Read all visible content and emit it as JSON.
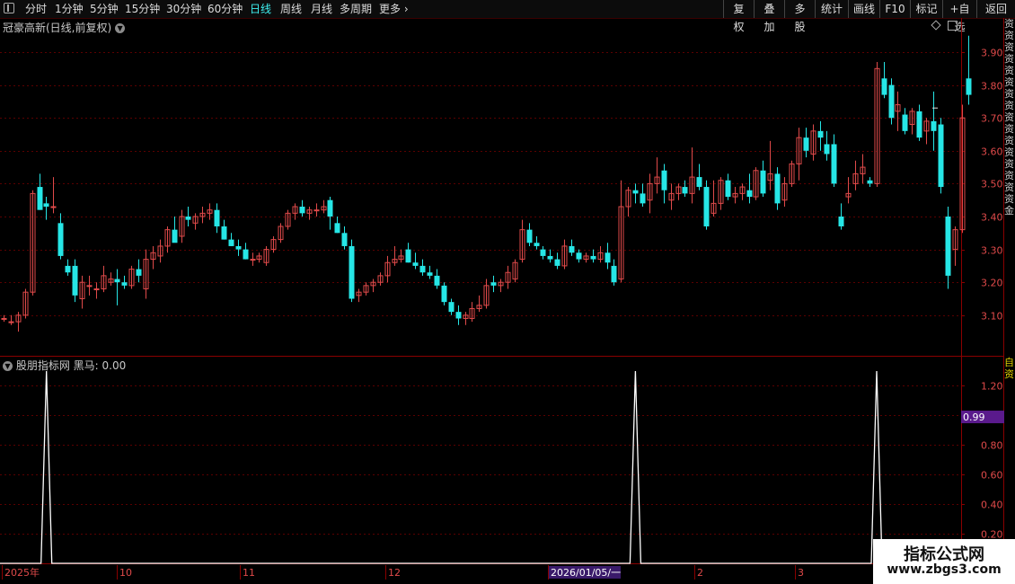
{
  "toolbar": {
    "periods": [
      {
        "label": "分时",
        "active": false
      },
      {
        "label": "1分钟",
        "active": false
      },
      {
        "label": "5分钟",
        "active": false
      },
      {
        "label": "15分钟",
        "active": false
      },
      {
        "label": "30分钟",
        "active": false
      },
      {
        "label": "60分钟",
        "active": false
      },
      {
        "label": "日线",
        "active": true
      },
      {
        "label": "周线",
        "active": false
      },
      {
        "label": "月线",
        "active": false
      },
      {
        "label": "多周期",
        "active": false
      },
      {
        "label": "更多",
        "active": false
      }
    ],
    "right_buttons": [
      "复权",
      "叠加",
      "多股",
      "统计",
      "画线",
      "F10",
      "标记",
      "+自选",
      "返回"
    ]
  },
  "main_title": "冠豪高新(日线,前复权)",
  "indicator_title": "股朋指标网",
  "indicator_value_text": "黑马: 0.00",
  "indicator_current_tag": "0.99",
  "right_strip_text": "资资资资资资资资资资资资资资资资金",
  "right_strip_text_lower": "自资",
  "watermark": {
    "title": "指标公式网",
    "url": "www.zbgs3.com"
  },
  "colors": {
    "up": "#e04a4a",
    "down": "#26e6e6",
    "grid": "#5a0000",
    "text": "#c8c8c8",
    "active": "#3ef0f0",
    "tag": "#5a1a8c"
  },
  "chart_data": [
    {
      "type": "candlestick",
      "title": "冠豪高新(日线,前复权)",
      "ylim": [
        3.0,
        3.98
      ],
      "yticks": [
        "3.90",
        "3.80",
        "3.70",
        "3.60",
        "3.50",
        "3.40",
        "3.30",
        "3.20",
        "3.10"
      ],
      "xticks": [
        "2025年",
        "10",
        "11",
        "12",
        "2026/01/05/一",
        "2",
        "3"
      ],
      "ohlc": [
        [
          3.09,
          3.1,
          3.08,
          3.09
        ],
        [
          3.08,
          3.1,
          3.07,
          3.08
        ],
        [
          3.08,
          3.11,
          3.05,
          3.1
        ],
        [
          3.1,
          3.18,
          3.09,
          3.17
        ],
        [
          3.17,
          3.48,
          3.16,
          3.47
        ],
        [
          3.49,
          3.53,
          3.42,
          3.42
        ],
        [
          3.44,
          3.46,
          3.39,
          3.43
        ],
        [
          3.43,
          3.52,
          3.41,
          3.43
        ],
        [
          3.38,
          3.41,
          3.27,
          3.28
        ],
        [
          3.25,
          3.27,
          3.22,
          3.23
        ],
        [
          3.25,
          3.27,
          3.14,
          3.16
        ],
        [
          3.15,
          3.22,
          3.12,
          3.2
        ],
        [
          3.19,
          3.22,
          3.16,
          3.19
        ],
        [
          3.18,
          3.2,
          3.15,
          3.18
        ],
        [
          3.18,
          3.25,
          3.17,
          3.22
        ],
        [
          3.2,
          3.23,
          3.19,
          3.21
        ],
        [
          3.21,
          3.24,
          3.13,
          3.2
        ],
        [
          3.2,
          3.22,
          3.18,
          3.19
        ],
        [
          3.19,
          3.25,
          3.18,
          3.24
        ],
        [
          3.24,
          3.27,
          3.2,
          3.22
        ],
        [
          3.18,
          3.3,
          3.15,
          3.27
        ],
        [
          3.27,
          3.31,
          3.24,
          3.29
        ],
        [
          3.28,
          3.33,
          3.26,
          3.31
        ],
        [
          3.31,
          3.37,
          3.29,
          3.36
        ],
        [
          3.36,
          3.4,
          3.33,
          3.32
        ],
        [
          3.34,
          3.42,
          3.32,
          3.4
        ],
        [
          3.4,
          3.43,
          3.37,
          3.39
        ],
        [
          3.38,
          3.41,
          3.36,
          3.4
        ],
        [
          3.4,
          3.43,
          3.38,
          3.41
        ],
        [
          3.41,
          3.44,
          3.39,
          3.42
        ],
        [
          3.42,
          3.44,
          3.35,
          3.37
        ],
        [
          3.37,
          3.39,
          3.33,
          3.33
        ],
        [
          3.33,
          3.35,
          3.31,
          3.31
        ],
        [
          3.31,
          3.33,
          3.28,
          3.3
        ],
        [
          3.3,
          3.32,
          3.27,
          3.27
        ],
        [
          3.27,
          3.29,
          3.25,
          3.27
        ],
        [
          3.27,
          3.29,
          3.26,
          3.28
        ],
        [
          3.26,
          3.31,
          3.25,
          3.3
        ],
        [
          3.3,
          3.34,
          3.29,
          3.33
        ],
        [
          3.33,
          3.38,
          3.32,
          3.37
        ],
        [
          3.37,
          3.42,
          3.36,
          3.41
        ],
        [
          3.41,
          3.44,
          3.39,
          3.43
        ],
        [
          3.43,
          3.45,
          3.4,
          3.41
        ],
        [
          3.41,
          3.43,
          3.39,
          3.42
        ],
        [
          3.42,
          3.44,
          3.4,
          3.42
        ],
        [
          3.42,
          3.45,
          3.41,
          3.43
        ],
        [
          3.45,
          3.46,
          3.36,
          3.4
        ],
        [
          3.38,
          3.4,
          3.35,
          3.35
        ],
        [
          3.35,
          3.37,
          3.3,
          3.31
        ],
        [
          3.31,
          3.33,
          3.14,
          3.15
        ],
        [
          3.16,
          3.18,
          3.14,
          3.17
        ],
        [
          3.17,
          3.2,
          3.16,
          3.19
        ],
        [
          3.19,
          3.21,
          3.17,
          3.2
        ],
        [
          3.2,
          3.23,
          3.19,
          3.22
        ],
        [
          3.22,
          3.28,
          3.2,
          3.26
        ],
        [
          3.26,
          3.31,
          3.25,
          3.27
        ],
        [
          3.27,
          3.3,
          3.26,
          3.28
        ],
        [
          3.3,
          3.32,
          3.26,
          3.26
        ],
        [
          3.26,
          3.29,
          3.24,
          3.25
        ],
        [
          3.25,
          3.27,
          3.22,
          3.23
        ],
        [
          3.23,
          3.25,
          3.21,
          3.22
        ],
        [
          3.22,
          3.24,
          3.18,
          3.19
        ],
        [
          3.19,
          3.2,
          3.13,
          3.14
        ],
        [
          3.14,
          3.15,
          3.1,
          3.11
        ],
        [
          3.11,
          3.13,
          3.07,
          3.09
        ],
        [
          3.09,
          3.11,
          3.07,
          3.1
        ],
        [
          3.09,
          3.14,
          3.08,
          3.12
        ],
        [
          3.12,
          3.16,
          3.11,
          3.13
        ],
        [
          3.13,
          3.21,
          3.12,
          3.19
        ],
        [
          3.2,
          3.22,
          3.17,
          3.19
        ],
        [
          3.19,
          3.21,
          3.17,
          3.2
        ],
        [
          3.2,
          3.25,
          3.18,
          3.23
        ],
        [
          3.21,
          3.27,
          3.2,
          3.26
        ],
        [
          3.27,
          3.39,
          3.26,
          3.36
        ],
        [
          3.36,
          3.38,
          3.31,
          3.32
        ],
        [
          3.32,
          3.34,
          3.3,
          3.31
        ],
        [
          3.3,
          3.31,
          3.27,
          3.28
        ],
        [
          3.28,
          3.3,
          3.26,
          3.27
        ],
        [
          3.27,
          3.29,
          3.24,
          3.25
        ],
        [
          3.25,
          3.33,
          3.24,
          3.31
        ],
        [
          3.31,
          3.33,
          3.28,
          3.29
        ],
        [
          3.29,
          3.3,
          3.26,
          3.27
        ],
        [
          3.27,
          3.29,
          3.26,
          3.28
        ],
        [
          3.28,
          3.3,
          3.26,
          3.27
        ],
        [
          3.27,
          3.31,
          3.26,
          3.29
        ],
        [
          3.29,
          3.32,
          3.24,
          3.26
        ],
        [
          3.25,
          3.27,
          3.19,
          3.2
        ],
        [
          3.21,
          3.51,
          3.2,
          3.43
        ],
        [
          3.43,
          3.49,
          3.4,
          3.48
        ],
        [
          3.48,
          3.5,
          3.44,
          3.47
        ],
        [
          3.47,
          3.5,
          3.43,
          3.44
        ],
        [
          3.45,
          3.53,
          3.41,
          3.5
        ],
        [
          3.5,
          3.58,
          3.47,
          3.52
        ],
        [
          3.54,
          3.56,
          3.44,
          3.48
        ],
        [
          3.45,
          3.5,
          3.42,
          3.47
        ],
        [
          3.47,
          3.5,
          3.45,
          3.49
        ],
        [
          3.49,
          3.51,
          3.46,
          3.47
        ],
        [
          3.47,
          3.61,
          3.44,
          3.52
        ],
        [
          3.52,
          3.56,
          3.48,
          3.49
        ],
        [
          3.49,
          3.51,
          3.36,
          3.37
        ],
        [
          3.41,
          3.51,
          3.4,
          3.44
        ],
        [
          3.44,
          3.52,
          3.42,
          3.51
        ],
        [
          3.51,
          3.53,
          3.45,
          3.46
        ],
        [
          3.46,
          3.49,
          3.44,
          3.47
        ],
        [
          3.47,
          3.5,
          3.45,
          3.49
        ],
        [
          3.48,
          3.53,
          3.44,
          3.46
        ],
        [
          3.46,
          3.55,
          3.45,
          3.54
        ],
        [
          3.54,
          3.57,
          3.46,
          3.47
        ],
        [
          3.51,
          3.63,
          3.48,
          3.53
        ],
        [
          3.53,
          3.55,
          3.42,
          3.44
        ],
        [
          3.45,
          3.52,
          3.43,
          3.5
        ],
        [
          3.5,
          3.57,
          3.49,
          3.56
        ],
        [
          3.56,
          3.67,
          3.51,
          3.64
        ],
        [
          3.64,
          3.67,
          3.58,
          3.6
        ],
        [
          3.59,
          3.68,
          3.57,
          3.66
        ],
        [
          3.66,
          3.69,
          3.6,
          3.64
        ],
        [
          3.62,
          3.66,
          3.57,
          3.59
        ],
        [
          3.62,
          3.65,
          3.49,
          3.5
        ],
        [
          3.4,
          3.44,
          3.36,
          3.37
        ],
        [
          3.46,
          3.52,
          3.44,
          3.47
        ],
        [
          3.5,
          3.57,
          3.48,
          3.53
        ],
        [
          3.53,
          3.59,
          3.5,
          3.55
        ],
        [
          3.51,
          3.52,
          3.49,
          3.5
        ],
        [
          3.5,
          3.87,
          3.49,
          3.85
        ],
        [
          3.82,
          3.87,
          3.76,
          3.77
        ],
        [
          3.8,
          3.82,
          3.68,
          3.7
        ],
        [
          3.72,
          3.78,
          3.66,
          3.74
        ],
        [
          3.71,
          3.73,
          3.65,
          3.66
        ],
        [
          3.68,
          3.73,
          3.65,
          3.72
        ],
        [
          3.72,
          3.74,
          3.63,
          3.64
        ],
        [
          3.66,
          3.7,
          3.62,
          3.69
        ],
        [
          3.69,
          3.78,
          3.6,
          3.66
        ],
        [
          3.68,
          3.7,
          3.47,
          3.49
        ],
        [
          3.4,
          3.43,
          3.18,
          3.22
        ],
        [
          3.3,
          3.37,
          3.25,
          3.36
        ],
        [
          3.36,
          3.74,
          3.35,
          3.7
        ],
        [
          3.82,
          3.95,
          3.74,
          3.77
        ]
      ],
      "last_price_marker": 3.73
    },
    {
      "type": "line",
      "name": "黑马",
      "ylim": [
        0,
        1.39
      ],
      "yticks": [
        "1.20",
        "1.00",
        "0.80",
        "0.60",
        "0.40",
        "0.20"
      ],
      "spikes": [
        {
          "bar": 3,
          "value": 1.3
        },
        {
          "bar": 86,
          "value": 1.3
        },
        {
          "bar": 120,
          "value": 1.3
        }
      ],
      "baseline": 0.0,
      "current_value": 0.99
    }
  ]
}
